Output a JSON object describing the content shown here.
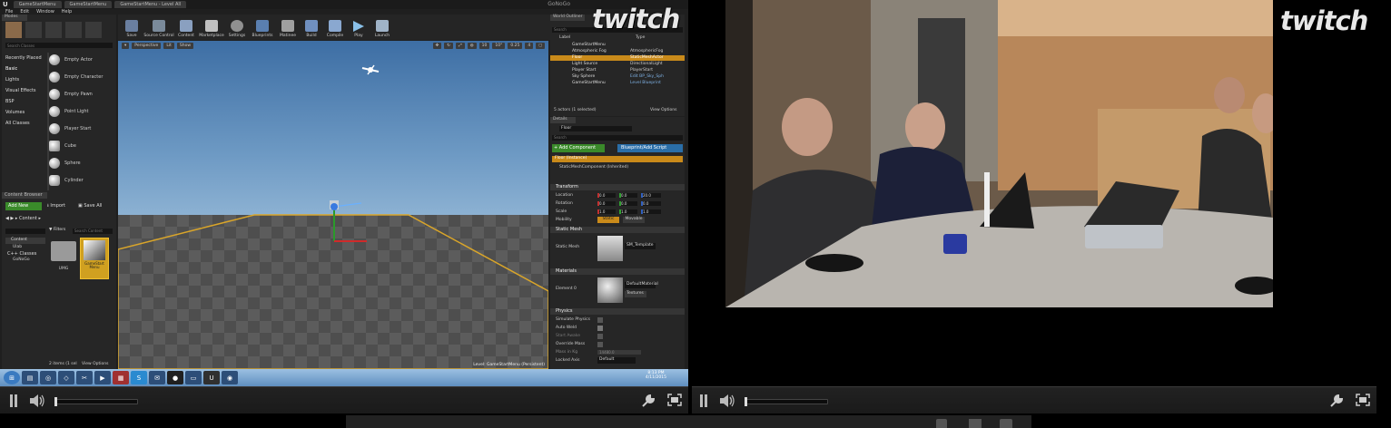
{
  "ue": {
    "tabs": [
      "GameStartMenu",
      "GameStartMenu",
      "GameStartMenu - Level All"
    ],
    "brand": "GoNoGo",
    "menu": [
      "File",
      "Edit",
      "Window",
      "Help"
    ],
    "toolbar": [
      "Save",
      "Source Control",
      "Content",
      "Marketplace",
      "Settings",
      "Blueprints",
      "Matinee",
      "Build",
      "Compile",
      "Play",
      "Launch"
    ],
    "modes": {
      "header": "Modes",
      "search_placeholder": "Search Classes",
      "categories": [
        "Recently Placed",
        "Basic",
        "Lights",
        "Visual Effects",
        "BSP",
        "Volumes",
        "All Classes"
      ],
      "items": [
        "Empty Actor",
        "Empty Character",
        "Empty Pawn",
        "Point Light",
        "Player Start",
        "Cube",
        "Sphere",
        "Cylinder"
      ]
    },
    "content_browser": {
      "header": "Content Browser",
      "add_new": "Add New",
      "import": "Import",
      "save_all": "Save All",
      "path": "Content",
      "filters": "Filters",
      "search_placeholder": "Search Content",
      "tree": [
        "Content",
        "Ulab",
        "C++ Classes",
        "GoNoGo"
      ],
      "assets": [
        "UMG",
        "GameStart Menu"
      ],
      "status": "2 items (1 sel",
      "view_options": "View Options"
    },
    "viewport": {
      "perspective": "Perspective",
      "lit": "Lit",
      "show": "Show",
      "grid_snap": "10",
      "rot_snap": "10°",
      "scale_snap": "0.25",
      "cam_speed": "4",
      "level_label": "Level:",
      "level_name": "GameStartMenu (Persistent)"
    },
    "outliner": {
      "header": "World Outliner",
      "search_placeholder": "Search",
      "col_label": "Label",
      "col_type": "Type",
      "rows": [
        {
          "label": "GameStartMenu",
          "type": ""
        },
        {
          "label": "Atmospheric Fog",
          "type": "AtmosphericFog"
        },
        {
          "label": "Floor",
          "type": "StaticMeshActor"
        },
        {
          "label": "Light Source",
          "type": "DirectionalLight"
        },
        {
          "label": "Player Start",
          "type": "PlayerStart"
        },
        {
          "label": "Sky Sphere",
          "type": "Edit BP_Sky_Sph"
        },
        {
          "label": "GameStartMenu",
          "type": "Level Blueprint"
        }
      ],
      "status": "5 actors (1 selected)",
      "view_options": "View Options"
    },
    "details": {
      "header": "Details",
      "name": "Floor",
      "search_placeholder": "Search",
      "add_component": "+ Add Component",
      "blueprint": "Blueprint/Add Script",
      "instance": "Floor (Instance)",
      "component": "StaticMeshComponent (Inherited)",
      "transform": "Transform",
      "location": "Location",
      "rotation": "Rotation",
      "scale": "Scale",
      "location_values": [
        "0.0",
        "0.0",
        "20.0"
      ],
      "rotation_values": [
        "0.0",
        "0.0",
        "0.0"
      ],
      "scale_values": [
        "1.0",
        "1.0",
        "1.0"
      ],
      "mobility": "Mobility",
      "static": "Static",
      "movable": "Movable",
      "static_mesh_section": "Static Mesh",
      "static_mesh_label": "Static Mesh",
      "static_mesh_value": "SM_Template",
      "materials_section": "Materials",
      "element": "Element 0",
      "material_value": "DefaultMaterial",
      "textures": "Textures",
      "physics_section": "Physics",
      "physics_rows": [
        "Simulate Physics",
        "Auto Weld",
        "Start Awake",
        "Override Mass",
        "Mass in Kg",
        "Locked Axis"
      ],
      "mass_value": "14480.0",
      "locked_axis_value": "Default"
    },
    "clock": {
      "time": "8:13 PM",
      "date": "4/11/2015"
    },
    "taskbar_icons": [
      "windows-icon",
      "file-icon",
      "chrome-icon",
      "dropbox-icon",
      "tools-icon",
      "media-icon",
      "store-icon",
      "skype-icon",
      "chat-icon",
      "obs-icon",
      "folder-icon",
      "unreal-icon",
      "globe-icon"
    ]
  },
  "twitch": {
    "logo_text": "twitch"
  },
  "colors": {
    "accent_green": "#3a8a2a",
    "accent_blue": "#2a6ea8",
    "selection": "#c98a1a"
  }
}
